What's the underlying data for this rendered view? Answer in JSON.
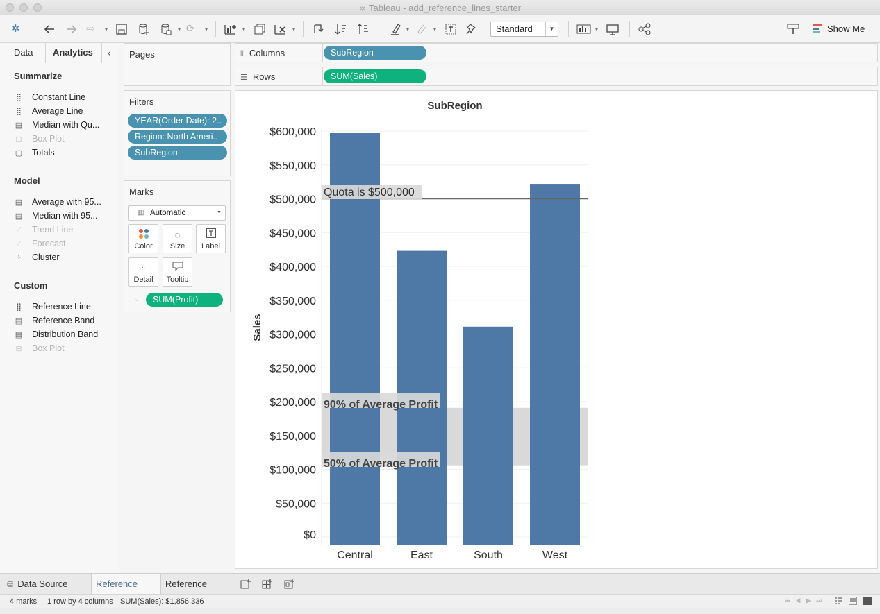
{
  "window": {
    "title": "Tableau - add_reference_lines_starter"
  },
  "toolbar": {
    "view_mode": "Standard",
    "show_me_label": "Show Me"
  },
  "left_pane": {
    "tabs": [
      "Data",
      "Analytics"
    ],
    "sections": [
      {
        "title": "Summarize",
        "items": [
          {
            "label": "Constant Line",
            "icon": "constant-line-icon",
            "enabled": true
          },
          {
            "label": "Average Line",
            "icon": "average-line-icon",
            "enabled": true
          },
          {
            "label": "Median with Qu...",
            "icon": "median-quartiles-icon",
            "enabled": true
          },
          {
            "label": "Box Plot",
            "icon": "box-plot-icon",
            "enabled": false
          },
          {
            "label": "Totals",
            "icon": "totals-icon",
            "enabled": true
          }
        ]
      },
      {
        "title": "Model",
        "items": [
          {
            "label": "Average with 95...",
            "icon": "average-ci-icon",
            "enabled": true
          },
          {
            "label": "Median with 95...",
            "icon": "median-ci-icon",
            "enabled": true
          },
          {
            "label": "Trend Line",
            "icon": "trend-line-icon",
            "enabled": false
          },
          {
            "label": "Forecast",
            "icon": "forecast-icon",
            "enabled": false
          },
          {
            "label": "Cluster",
            "icon": "cluster-icon",
            "enabled": true
          }
        ]
      },
      {
        "title": "Custom",
        "items": [
          {
            "label": "Reference Line",
            "icon": "reference-line-icon",
            "enabled": true
          },
          {
            "label": "Reference Band",
            "icon": "reference-band-icon",
            "enabled": true
          },
          {
            "label": "Distribution Band",
            "icon": "distribution-band-icon",
            "enabled": true
          },
          {
            "label": "Box Plot",
            "icon": "box-plot-icon",
            "enabled": false
          }
        ]
      }
    ]
  },
  "cards": {
    "pages_title": "Pages",
    "filters_title": "Filters",
    "filters": [
      "YEAR(Order Date): 2..",
      "Region: North Ameri..",
      "SubRegion"
    ],
    "marks_title": "Marks",
    "mark_type": "Automatic",
    "mark_buttons": [
      "Color",
      "Size",
      "Label",
      "Detail",
      "Tooltip"
    ],
    "marks_field": "SUM(Profit)"
  },
  "shelves": {
    "columns_label": "Columns",
    "columns_pill": "SubRegion",
    "rows_label": "Rows",
    "rows_pill": "SUM(Sales)"
  },
  "chart_data": {
    "type": "bar",
    "title": "SubRegion",
    "xlabel": "",
    "ylabel": "Sales",
    "categories": [
      "Central",
      "East",
      "South",
      "West"
    ],
    "values": [
      597000,
      423000,
      311000,
      522000
    ],
    "ylim": [
      0,
      620000
    ],
    "yticks": [
      0,
      50000,
      100000,
      150000,
      200000,
      250000,
      300000,
      350000,
      400000,
      450000,
      500000,
      550000,
      600000
    ],
    "ytick_labels": [
      "$0",
      "$50,000",
      "$100,000",
      "$150,000",
      "$200,000",
      "$250,000",
      "$300,000",
      "$350,000",
      "$400,000",
      "$450,000",
      "$500,000",
      "$550,000",
      "$600,000"
    ],
    "bar_color": "#4e79a7",
    "reference_line": {
      "value": 500000,
      "label": "Quota is $500,000"
    },
    "reference_band": {
      "from": 106000,
      "to": 191000,
      "upper_label": "90% of Average Profit",
      "lower_label": "50% of Average Profit",
      "color": "#d9d9d9"
    }
  },
  "bottom_tabs": [
    "Data Source",
    "Reference Line",
    "Reference Band"
  ],
  "active_tab": "Reference Line",
  "status": {
    "marks": "4 marks",
    "layout": "1 row by 4 columns",
    "sum": "SUM(Sales): $1,856,336"
  }
}
